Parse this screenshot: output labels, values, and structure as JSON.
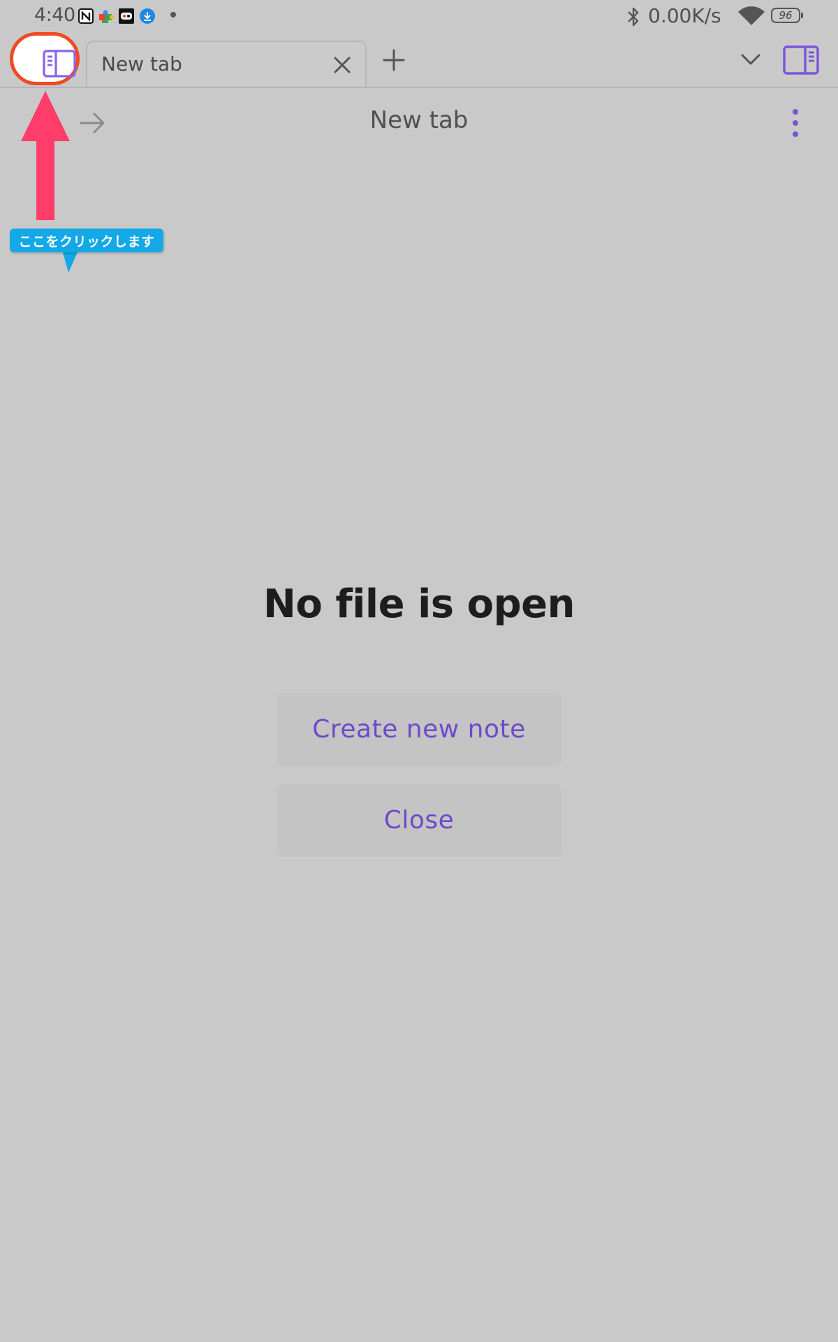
{
  "status_bar": {
    "time": "4:40",
    "network_speed": "0.00K/s",
    "battery": "96",
    "icons": [
      "notion-icon",
      "puzzle-icon",
      "game-icon",
      "download-icon",
      "bluetooth-icon",
      "wifi-icon",
      "battery-icon"
    ]
  },
  "tab_bar": {
    "tabs": [
      {
        "label": "New tab",
        "active": true
      }
    ],
    "icons": [
      "left-sidebar-icon",
      "close-icon",
      "plus-icon",
      "chevron-down-icon",
      "right-sidebar-icon"
    ]
  },
  "view_header": {
    "title": "New tab",
    "icons": [
      "arrow-right-icon",
      "more-vertical-icon"
    ]
  },
  "annotation": {
    "bubble_text": "ここをクリックします",
    "circle_color": "#ef4a24",
    "arrow_color": "#ff3d6a",
    "bubble_color": "#13a8e6"
  },
  "empty_state": {
    "title": "No file is open",
    "buttons": {
      "create": "Create new note",
      "close": "Close"
    }
  },
  "colors": {
    "background": "#c9c9c9",
    "accent": "#6f49cc",
    "accent_icon": "#8a63e8"
  }
}
